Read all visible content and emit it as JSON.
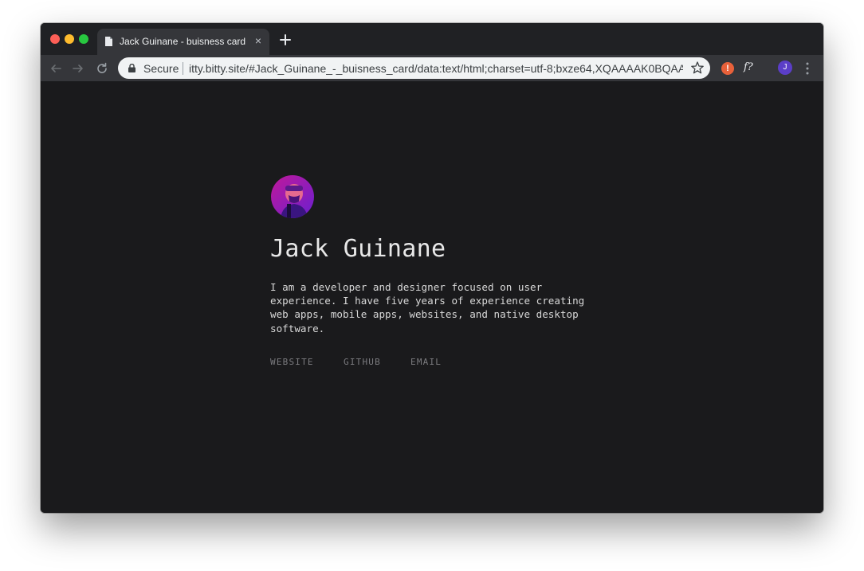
{
  "browser": {
    "tab": {
      "title": "Jack Guinane - buisness card",
      "close_glyph": "×"
    },
    "address_bar": {
      "security_label": "Secure",
      "url": "itty.bitty.site/#Jack_Guinane_-_buisness_card/data:text/html;charset=utf-8;bxze64,XQAAAAK0BQAAAA..."
    },
    "extensions": {
      "alert_badge": "!",
      "fx_label": "f?"
    },
    "profile_initial": "J"
  },
  "card": {
    "name": "Jack Guinane",
    "bio_lines": [
      "I am a developer and designer focused on user",
      "experience. I have five years of experience creating",
      "web apps, mobile apps, websites, and native desktop",
      "software."
    ],
    "links": [
      "WEBSITE",
      "GITHUB",
      "EMAIL"
    ]
  },
  "colors": {
    "page_background": "#1a1a1c",
    "tab_strip": "#202124",
    "toolbar": "#35363a",
    "avatar_gradient": [
      "#c0199a",
      "#6a1fd0"
    ]
  },
  "icons": {
    "close_window": "close-window-icon",
    "minimize_window": "minimize-window-icon",
    "zoom_window": "zoom-window-icon",
    "tab_favicon": "document-icon",
    "new_tab": "plus-icon",
    "back": "back-arrow-icon",
    "forward": "forward-arrow-icon",
    "reload": "reload-icon",
    "lock": "lock-icon",
    "bookmark": "star-icon",
    "menu": "kebab-menu-icon"
  }
}
